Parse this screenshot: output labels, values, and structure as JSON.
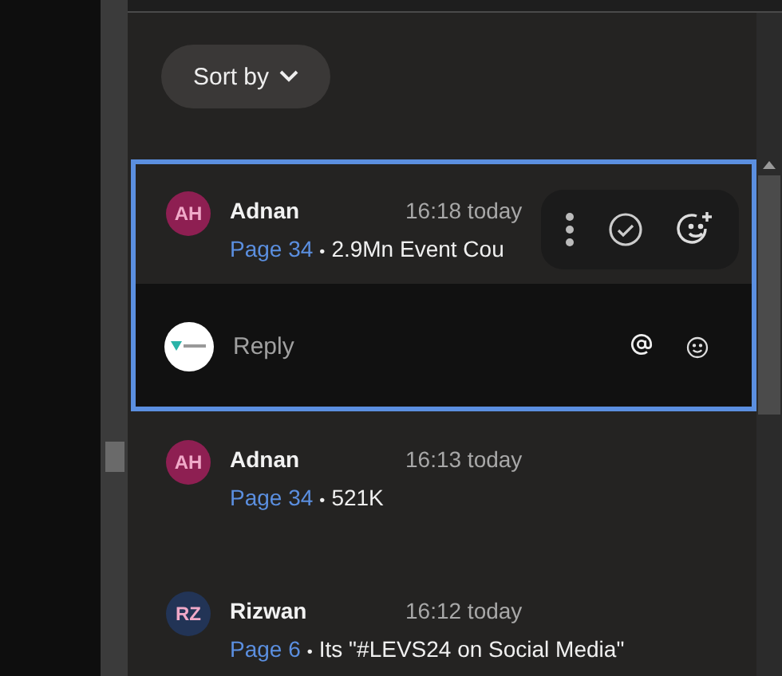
{
  "sort_button": {
    "label": "Sort by"
  },
  "comments": [
    {
      "initials": "AH",
      "color": "#8e1f52",
      "author": "Adnan",
      "time": "16:18 today",
      "page": "Page 34",
      "separator": "•",
      "text": "2.9Mn Event Cou",
      "selected": true,
      "reply": {
        "placeholder": "Reply"
      }
    },
    {
      "initials": "AH",
      "color": "#8e1f52",
      "author": "Adnan",
      "time": "16:13 today",
      "page": "Page 34",
      "separator": "•",
      "text": "521K",
      "selected": false
    },
    {
      "initials": "RZ",
      "color": "#223456",
      "author": "Rizwan",
      "time": "16:12 today",
      "page": "Page 6",
      "separator": "•",
      "text": "Its \"#LEVS24 on Social Media\"",
      "selected": false
    }
  ]
}
